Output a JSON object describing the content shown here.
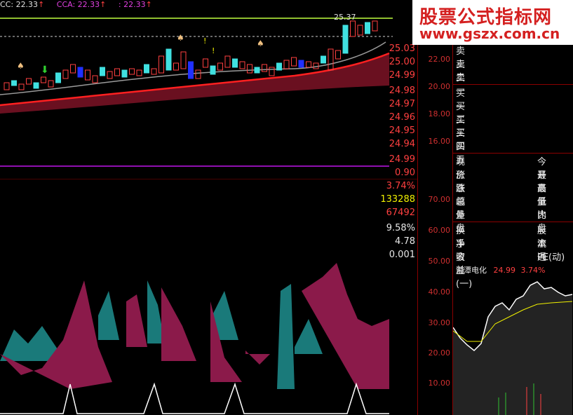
{
  "legend": {
    "cc": "CC: 22.33",
    "cca": "CCA: 22.33",
    "third": ": 22.33",
    "arrow": "↑"
  },
  "price_label": "25.37",
  "price_axis_ticks": [
    "22.00",
    "20.00",
    "18.00",
    "16.00"
  ],
  "osc_axis_ticks": [
    "70.00",
    "60.00",
    "50.00",
    "40.00",
    "30.00",
    "20.00",
    "10.00"
  ],
  "banner": {
    "title": "股票公式指标网",
    "url": "www.gszx.com.cn"
  },
  "quote": {
    "sell": [
      {
        "label": "卖三",
        "price": "25.03"
      },
      {
        "label": "卖二",
        "price": "25.00"
      },
      {
        "label": "卖一",
        "price": "24.99"
      }
    ],
    "buy": [
      {
        "label": "买一",
        "price": "24.98"
      },
      {
        "label": "买二",
        "price": "24.97"
      },
      {
        "label": "买三",
        "price": "24.96"
      },
      {
        "label": "买四",
        "price": "24.95"
      },
      {
        "label": "买五",
        "price": "24.94"
      }
    ],
    "stats": [
      {
        "k": "现价",
        "v": "24.99",
        "k2": "今开"
      },
      {
        "k": "涨跌",
        "v": "0.90",
        "k2": "最高"
      },
      {
        "k": "涨幅",
        "v": "3.74%",
        "k2": "最低"
      },
      {
        "k": "总量",
        "v": "133288",
        "k2": "量比"
      },
      {
        "k": "外盘",
        "v": "67492",
        "k2": "内盘"
      },
      {
        "k": "换手",
        "v": "9.58%",
        "k2": "股本"
      },
      {
        "k": "净资",
        "v": "4.78",
        "k2": "流通"
      },
      {
        "k": "收益(一)",
        "v": "0.001",
        "k2": "PE(动)"
      }
    ],
    "mini": {
      "name": "湘潭电化",
      "price": "24.99",
      "pct": "3.74%"
    }
  },
  "colors": {
    "up": "#ff4040",
    "down": "#40e0e0",
    "magenta": "#8b1a4a",
    "teal": "#1a7a7a",
    "yellow": "#f0f000"
  }
}
